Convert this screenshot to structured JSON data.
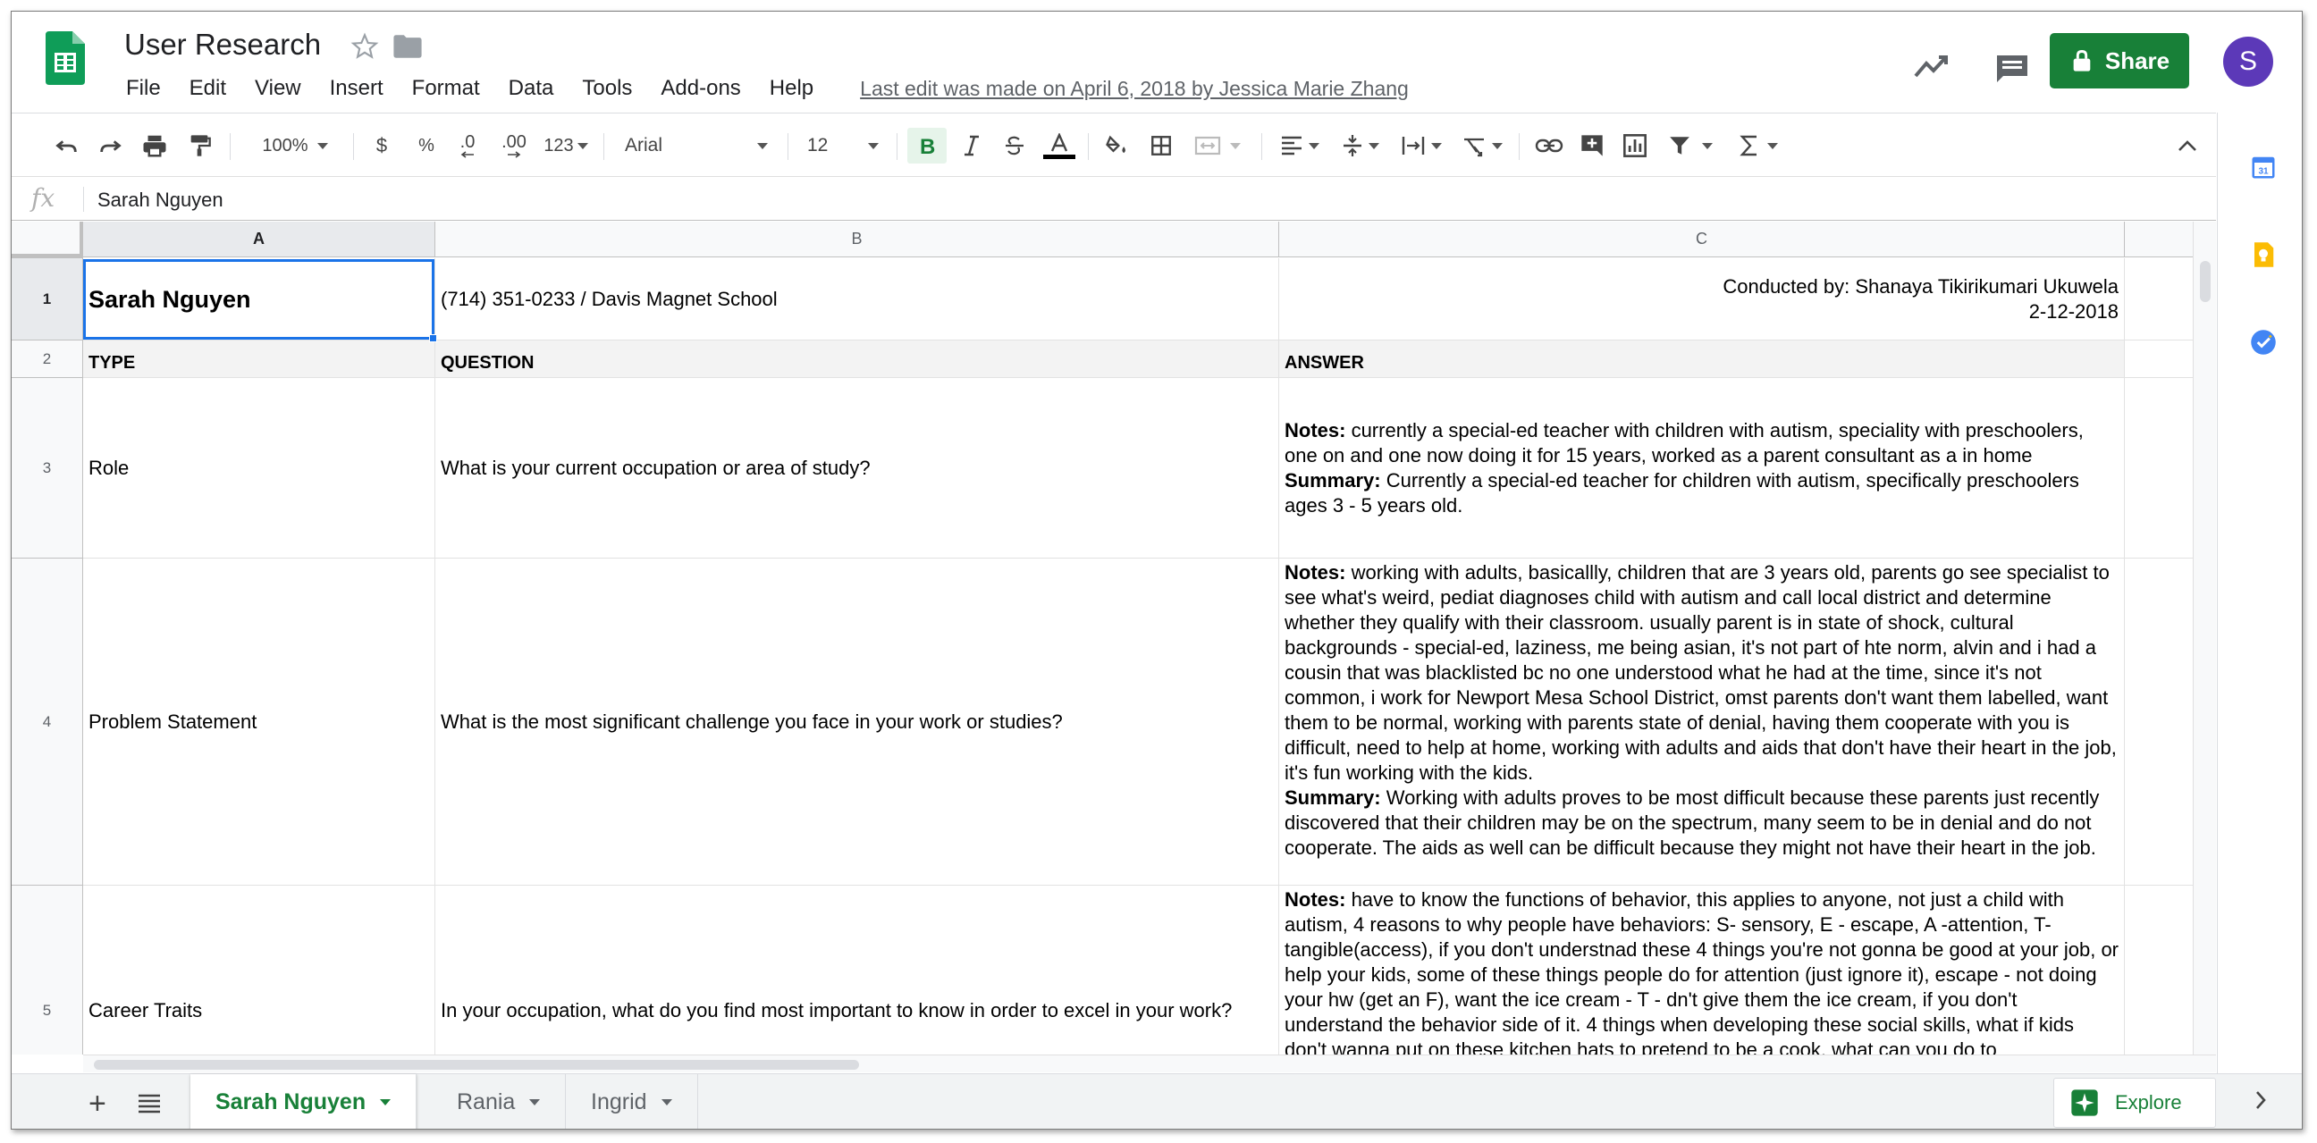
{
  "header": {
    "title": "User Research",
    "last_edit": "Last edit was made on April 6, 2018 by Jessica Marie Zhang",
    "menu": [
      "File",
      "Edit",
      "View",
      "Insert",
      "Format",
      "Data",
      "Tools",
      "Add-ons",
      "Help"
    ],
    "share_label": "Share",
    "avatar_initial": "S"
  },
  "toolbar": {
    "zoom": "100%",
    "currency": "$",
    "percent": "%",
    "decrease_decimal": ".0",
    "increase_decimal": ".00",
    "more_formats": "123",
    "font": "Arial",
    "font_size": "12"
  },
  "formula_bar": {
    "fx": "fx",
    "value": "Sarah Nguyen"
  },
  "grid": {
    "columns": [
      "A",
      "B",
      "C"
    ],
    "rows": [
      "1",
      "2",
      "3",
      "4",
      "5"
    ],
    "row1": {
      "a": "Sarah Nguyen",
      "b": "(714) 351-0233 / Davis Magnet School",
      "c1": "Conducted by: Shanaya Tikirikumari Ukuwela",
      "c2": "2-12-2018"
    },
    "row2": {
      "a": "TYPE",
      "b": "QUESTION",
      "c": "ANSWER"
    },
    "row3": {
      "a": "Role",
      "b": "What is your current occupation or area of study?",
      "notes_label": "Notes:",
      "notes": " currently a special-ed teacher with children with autism, speciality with preschoolers, one on and one now doing it for 15 years, worked as a parent consultant as a in home",
      "summary_label": "Summary:",
      "summary": " Currently a special-ed teacher for children with autism, specifically preschoolers ages 3 - 5 years old."
    },
    "row4": {
      "a": "Problem Statement",
      "b": "What is the most significant challenge you face in your work or studies?",
      "notes_label": "Notes:",
      "notes": " working with adults, basicallly, children that are 3 years old, parents go see specialist to see what's weird, pediat diagnoses child with autism and call local district and determine whether they qualify with their classroom. usually parent is in state of shock, cultural backgrounds - special-ed, laziness, me being asian, it's not part of hte norm, alvin and i had a cousin that was blacklisted bc no one understood what he had at the time, since it's not common, i work for Newport Mesa School District, omst parents don't want them labelled, want them to be normal, working with parents state of denial, having them cooperate with you is difficult, need to help at home, working with adults and aids that don't have their heart in the job, it's fun working with the kids.",
      "summary_label": "Summary:",
      "summary": " Working with adults proves to be most difficult because these parents just recently discovered that their children may be on the spectrum, many seem to be in denial and do not cooperate. The aids as well can be difficult because they might not have their heart in the job."
    },
    "row5": {
      "a": "Career Traits",
      "b": "In your occupation, what do you find most important to know in order to excel in your work?",
      "notes_label": "Notes:",
      "notes": " have to know the functions of behavior, this applies to anyone, not just a child with autism, 4 reasons to why people have behaviors: S- sensory, E - escape, A -attention, T- tangible(access), if you don't understnad these 4 things you're not gonna be good at your job, or help your kids, some of these things people do for attention (just ignore it), escape - not doing your hw (get an F), want the ice cream - T - dn't give them the ice cream, if you don't understand the behavior side of it. 4 things when developing these social skills, what if kids don't wanna put on these kitchen hats to pretend to be a cook, what can you do to"
    }
  },
  "sheets": [
    {
      "label": "Sarah Nguyen",
      "active": true
    },
    {
      "label": "Rania",
      "active": false
    },
    {
      "label": "Ingrid",
      "active": false
    }
  ],
  "explore_label": "Explore",
  "colors": {
    "brand_green": "#188038",
    "selection_blue": "#1a73e8",
    "avatar_purple": "#5c39b8"
  }
}
